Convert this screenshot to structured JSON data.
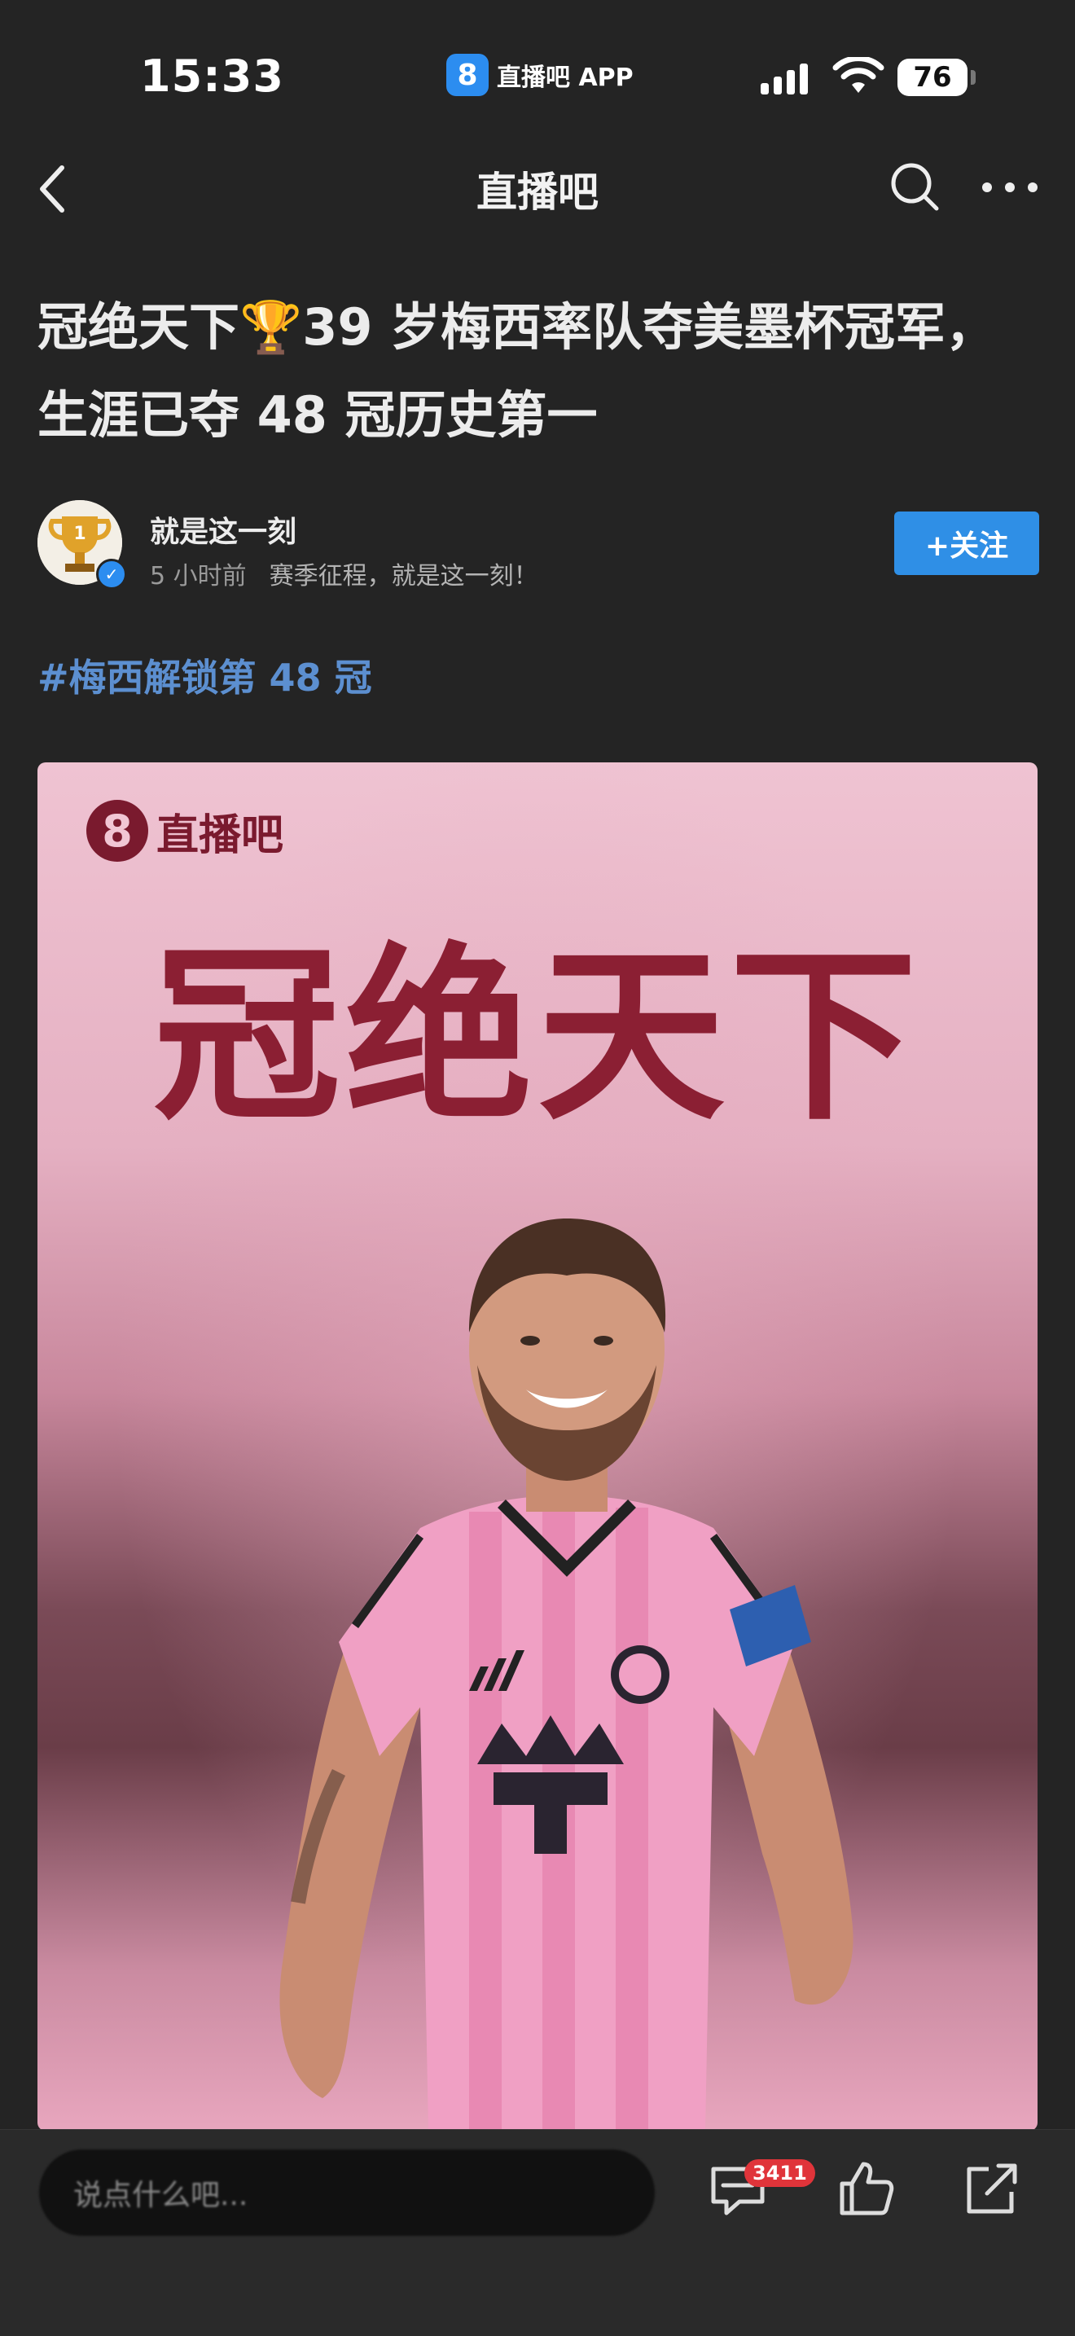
{
  "status_bar": {
    "time": "15:33",
    "app_badge": "8",
    "app_name": "直播吧 APP",
    "battery": "76"
  },
  "nav": {
    "title": "直播吧",
    "back_icon": "chevron-left-icon",
    "search_icon": "search-icon",
    "more_icon": "more-dots-icon"
  },
  "article": {
    "title": "冠绝天下🏆39 岁梅西率队夺美墨杯冠军，生涯已夺 48 冠历史第一",
    "author": {
      "name": "就是这一刻",
      "time": "5 小时前",
      "description": "赛季征程，就是这一刻！",
      "follow_label": "+关注"
    },
    "hashtag": "#梅西解锁第 48 冠",
    "poster": {
      "logo_badge": "8",
      "logo_text": "直播吧",
      "headline": "冠绝天下"
    }
  },
  "bottom_bar": {
    "comment_placeholder": "说点什么吧...",
    "comment_count": "3411",
    "icons": [
      "comment-icon",
      "thumbs-up-icon",
      "share-icon"
    ]
  }
}
